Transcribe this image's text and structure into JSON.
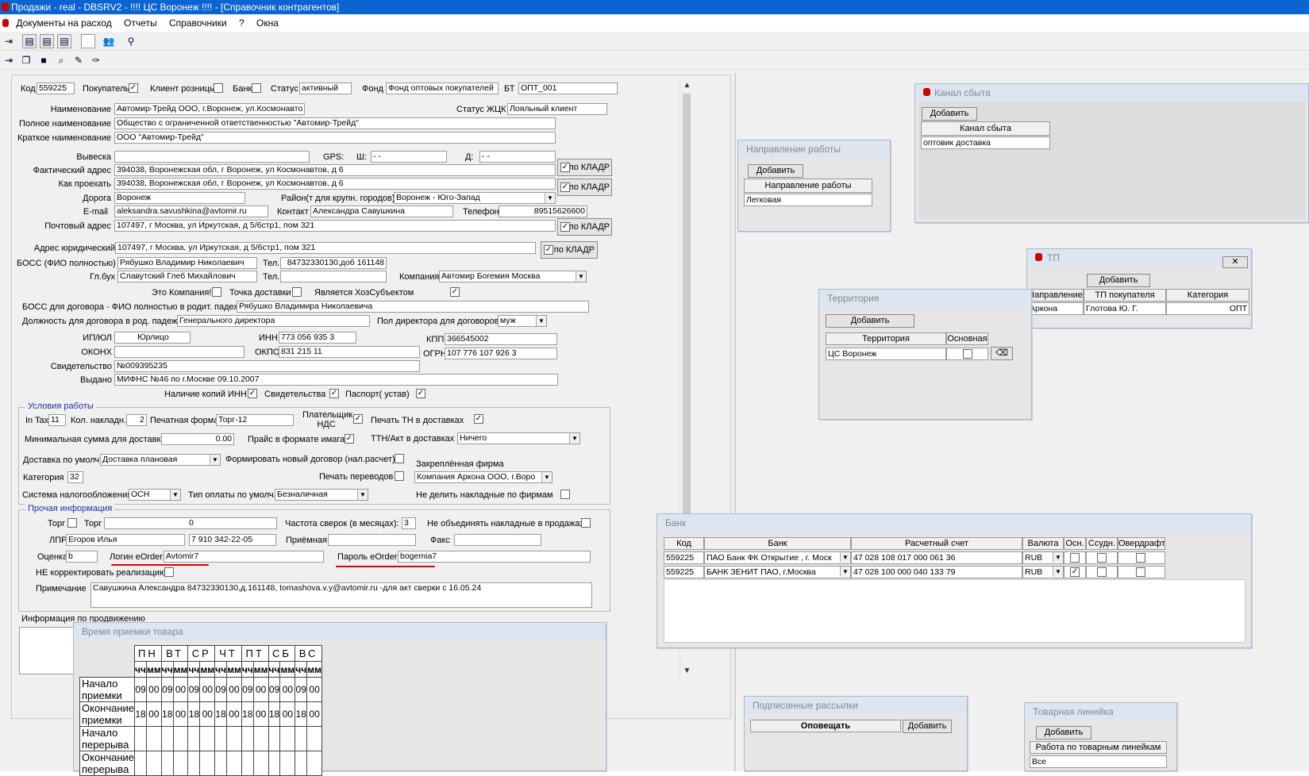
{
  "titlebar": {
    "text": "Продажи - real - DBSRV2 -    !!!! ЦС Воронеж !!!! - [Справочник контрагентов]"
  },
  "menu": [
    "Документы на расход",
    "Отчеты",
    "Справочники",
    "?",
    "Окна"
  ],
  "form": {
    "code_label": "Код",
    "code": "559225",
    "buyer_label": "Покупатель",
    "retail_label": "Клиент розницы",
    "bank_label": "Банк",
    "status_label": "Статус",
    "status": "активный",
    "fund_label": "Фонд",
    "fund": "Фонд оптовых покупателей",
    "bt_label": "БТ",
    "bt": "ОПТ_001",
    "name_label": "Наименование",
    "name": "Автомир-Трейд ООО, г.Воронеж, ул.Космонавто",
    "zhck_label": "Статус ЖЦК",
    "zhck": "Лояльный клиент",
    "fullname_label": "Полное наименование",
    "fullname": "Общество с ограниченной ответственностью \"Автомир-Трейд\"",
    "shortname_label": "Краткое наименование",
    "shortname": "ООО \"Автомир-Трейд\"",
    "sign_label": "Вывеска",
    "gps_label": "GPS:",
    "lat_label": "Ш:",
    "lat": " - -",
    "lon_label": "Д:",
    "lon": " - -",
    "fact_label": "Фактический адрес",
    "fact": "394038, Воронежская обл, г Воронеж, ул Космонавтов, д 6",
    "how_label": "Как проехать",
    "how": "394038, Воронежская обл, г Воронеж, ул Космонавтов, д 6",
    "kladr": "по КЛАДР",
    "road_label": "Дорога",
    "road": "Воронеж",
    "district_label": "Район(т для крупн. городов)",
    "district": "Воронеж - Юго-Запад",
    "email_label": "E-mail",
    "email": "aleksandra.savushkina@avtomir.ru",
    "contact_label": "Контакт",
    "contact": "Александра Савушкина",
    "phone_label": "Телефон",
    "phone": "89515626600",
    "post_label": "Почтовый адрес",
    "post": "107497, г Москва, ул Иркутская, д 5/6стр1,  пом 321",
    "legal_label": "Адрес юридический",
    "legal": "107497, г Москва, ул Иркутская, д 5/6стр1,  пом 321",
    "boss_label": "БОСС (ФИО полностью)",
    "boss": "Рябушко Владимир Николаевич",
    "tel_label": "Тел.",
    "boss_tel": "84732330130,доб 161148",
    "acc_label": "Гл.бух",
    "acc": "Славутский Глеб Михайлович",
    "acc_tel": "",
    "company_label": "Компания",
    "company": "Автомир Богемия Москва",
    "is_company_label": "Это Компания!",
    "delivery_point_label": "Точка доставки",
    "hoz_label": "Является ХозСубъектом",
    "boss_gen_label": "БОСС для договора - ФИО полностью в родит. падеже",
    "boss_gen": "Рябушко Владимира Николаевича",
    "pos_label": "Должность для договора в род. падеже",
    "pos": "Генерального директора",
    "sex_label": "Пол директора для договоров",
    "sex": "муж",
    "ipul_label": "ИП/ЮЛ",
    "ipul": "Юрлицо",
    "inn_label": "ИНН",
    "inn": "773 056 935 3",
    "kpp_label": "КПП",
    "kpp": "366545002",
    "okonh_label": "ОКОНХ",
    "okpo_label": "ОКПО",
    "okpo": "831 215 11",
    "ogrn_label": "ОГРН",
    "ogrn": "107 776 107 926 3",
    "cert_label": "Свидетельство",
    "cert": "№009395235",
    "issued_label": "Выдано",
    "issued": "МИФНС №46 по г.Москве 09.10.2007",
    "copies_label": "Наличие копий ИНН",
    "certs_label": "Свидетельства",
    "passport_label": "Паспорт( устав)"
  },
  "work": {
    "title": "Условия работы",
    "intax_label": "In Tax",
    "intax": "11",
    "kol_label": "Кол. накладн.",
    "kol": "2",
    "print_label": "Печатная форма",
    "print": "Торг-12",
    "nds_label": "Плательщик НДС",
    "th_label": "Печать ТН в доставках",
    "minsum_label": "Минимальная сумма для доставки",
    "minsum": "0.00",
    "price_label": "Прайс в формате имага",
    "ttn_label": "ТТН/Акт в доставках",
    "ttn": "Ничего",
    "deliv_label": "Доставка по умолч",
    "deliv": "Доставка плановая",
    "newdog_label": "Формировать новый договор (нал.расчет)",
    "firm_label": "Закреплённая фирма",
    "firm": "Компания Аркона ООО, г.Воро",
    "printper_label": "Печать переводов",
    "cat_label": "Категория",
    "cat": "32",
    "tax_label": "Система налогообложения",
    "tax": "ОСН",
    "pay_label": "Тип оплаты по умолч.",
    "pay": "Безналичная",
    "split_label": "Не делить накладные по фирмам"
  },
  "other": {
    "title": "Прочая информация",
    "torg_label": "Торг",
    "torg2_label": "Торг",
    "torg": "0",
    "freq_label": "Частота сверок (в месяцах):",
    "freq": "3",
    "noagg_label": "Не объединять накладные в продажах",
    "lpr_label": "ЛПР",
    "lpr": "Егоров Илья",
    "lpr_tel": "7 910 342-22-05",
    "reception_label": "Приёмная",
    "fax_label": "Факс",
    "rating_label": "Оценка",
    "rating": "b",
    "login_label": "Логин eOrder:",
    "login": "Avtomir7",
    "password_label": "Пароль eOrder:",
    "password": "bogemia7",
    "noadj_label": "НЕ корректировать реализацию:",
    "note_label": "Примечание",
    "note": "Савушкина Александра  84732330130,д.161148, tomashova.v.y@avtomir.ru -для акт сверки с 16.05.24",
    "promo_label": "Информация по продвижению"
  },
  "schedule": {
    "title": "Время приемки товара",
    "days": [
      "ПН",
      "ВТ",
      "СР",
      "ЧТ",
      "ПТ",
      "СБ",
      "ВС"
    ],
    "hh": "чч",
    "mm": "мм",
    "rows": [
      {
        "label": "Начало приемки",
        "values": [
          "09",
          "00",
          "09",
          "00",
          "09",
          "00",
          "09",
          "00",
          "09",
          "00",
          "09",
          "00",
          "09",
          "00"
        ]
      },
      {
        "label": "Окончание приемки",
        "values": [
          "18",
          "00",
          "18",
          "00",
          "18",
          "00",
          "18",
          "00",
          "18",
          "00",
          "18",
          "00",
          "18",
          "00"
        ]
      },
      {
        "label": "Начало перерыва",
        "values": [
          "",
          "",
          "",
          "",
          "",
          "",
          "",
          "",
          "",
          "",
          "",
          "",
          "",
          ""
        ]
      },
      {
        "label": "Окончание перерыва",
        "values": [
          "",
          "",
          "",
          "",
          "",
          "",
          "",
          "",
          "",
          "",
          "",
          "",
          "",
          ""
        ]
      }
    ]
  },
  "channel": {
    "title": "Канал сбыта",
    "add": "Добавить",
    "col": "Канал сбыта",
    "value": "оптовик доставка"
  },
  "direction": {
    "title": "Направление работы",
    "add": "Добавить",
    "col": "Направление работы",
    "value": "Легковая"
  },
  "tp": {
    "title": "ТП",
    "add": "Добавить",
    "cols": [
      "Направление",
      "ТП покупателя",
      "Категория"
    ],
    "row": [
      "Аркона",
      "Глотова Ю. Г.",
      "ОПТ"
    ]
  },
  "territory": {
    "title": "Территория",
    "add": "Добавить",
    "cols": [
      "Территория",
      "Основная"
    ],
    "value": "ЦС Воронеж"
  },
  "bank": {
    "title": "Банк",
    "cols": [
      "Код",
      "Банк",
      "Расчетный счет",
      "Валюта",
      "Осн.",
      "Ссудн.",
      "Овердрафт"
    ],
    "rows": [
      {
        "code": "559225",
        "bank": "ПАО Банк ФК Открытие , г. Моск",
        "acc": "47 028 108 017 000 061 36",
        "cur": "RUB"
      },
      {
        "code": "559225",
        "bank": "БАНК ЗЕНИТ ПАО, г.Москва",
        "acc": "47 028 100 000 040 133 79",
        "cur": "RUB"
      }
    ]
  },
  "mailing": {
    "title": "Подписанные рассылки",
    "col": "Оповещать",
    "add": "Добавить"
  },
  "product": {
    "title": "Товарная линейка",
    "add": "Добавить",
    "col": "Работа по товарным линейкам",
    "value": "Все"
  },
  "colors": {
    "titlebar": "#0a64d2",
    "group_title": "#1f2fa8",
    "underline": "#d00000"
  }
}
